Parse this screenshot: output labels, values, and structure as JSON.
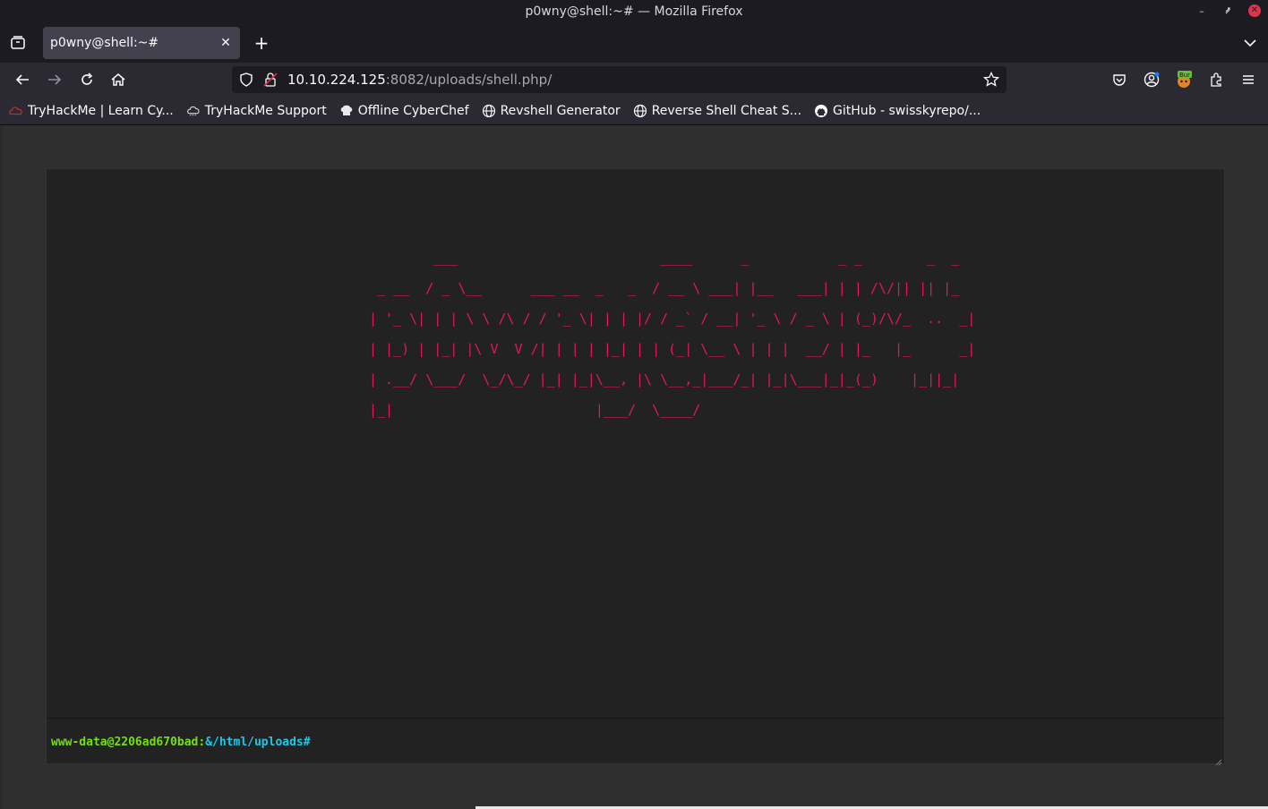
{
  "window": {
    "title": "p0wny@shell:~# — Mozilla Firefox"
  },
  "tab": {
    "title": "p0wny@shell:~#"
  },
  "urlbar": {
    "host": "10.10.224.125",
    "path": ":8082/uploads/shell.php/"
  },
  "bookmarks": [
    {
      "label": "TryHackMe | Learn Cy...",
      "icon": "tryhackme-icon"
    },
    {
      "label": "TryHackMe Support",
      "icon": "cloud-icon"
    },
    {
      "label": "Offline CyberChef",
      "icon": "chef-hat-icon"
    },
    {
      "label": "Revshell Generator",
      "icon": "globe-icon"
    },
    {
      "label": "Reverse Shell Cheat S...",
      "icon": "globe-icon"
    },
    {
      "label": "GitHub - swisskyrepo/...",
      "icon": "github-icon"
    }
  ],
  "shell": {
    "banner": "        ___                         ____      _           _ _        _  _\n _ __  / _ \\__      ___ __  _   _  / __ \\ ___| |__   ___| | | /\\/|| || |_\n| '_ \\| | | \\ \\ /\\ / / '_ \\| | | |/ / _` / __| '_ \\ / _ \\ | (_)/\\/_  ..  _|\n| |_) | |_| |\\ V  V /| | | | |_| | | (_| \\__ \\ | | |  __/ | |_   |_      _|\n| .__/ \\___/  \\_/\\_/ |_| |_|\\__, |\\ \\__,_|___/_| |_|\\___|_|_(_)    |_||_|\n|_|                         |___/  \\____/",
    "prompt_user": "www-data@2206ad670bad:",
    "prompt_path": "&/html/uploads",
    "prompt_hash": "#",
    "input_value": ""
  },
  "colors": {
    "banner": "#e2175f",
    "prompt_user": "#75df0b",
    "prompt_path": "#1bc9e7"
  }
}
